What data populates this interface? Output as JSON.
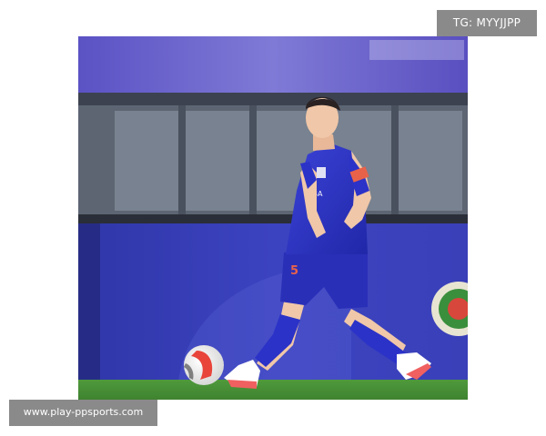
{
  "watermark_top": "TG: MYYJJPP",
  "watermark_bottom": "www.play-ppsports.com",
  "photo": {
    "subject": "football player in blue kit dribbling ball",
    "jersey_color": "#2b32c8",
    "shorts_color": "#2a2fb8",
    "armband_color": "#e8624a",
    "pitch_color": "#4a8a3a",
    "board_color": "#3b3fb5"
  }
}
